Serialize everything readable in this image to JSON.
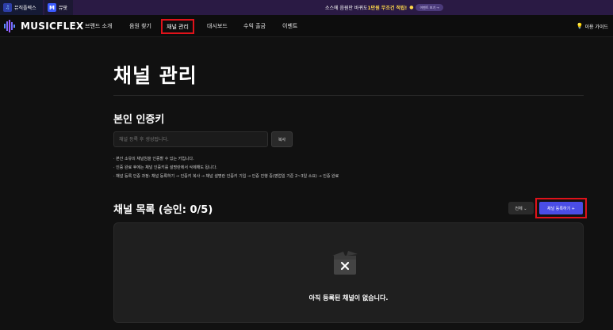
{
  "topbar": {
    "tabs": [
      {
        "label": "뮤직플렉스",
        "icon": "musicflex-icon"
      },
      {
        "label": "뮤팟",
        "icon": "M"
      }
    ],
    "promo": {
      "text_before": "소스에 음원만 바뀌도 ",
      "highlight": "1만원 무조건 적립!",
      "badge": "이벤트 보기 →"
    }
  },
  "nav": {
    "logo": "MUSICFLEX",
    "items": [
      "브랜드 소개",
      "음원 찾기",
      "채널 관리",
      "대시보드",
      "수익 출금",
      "이벤트"
    ],
    "active_index": 2,
    "guide": "이용 가이드"
  },
  "main": {
    "title": "채널 관리",
    "auth_key": {
      "title": "본인 인증키",
      "placeholder": "채널 등록 후 생성됩니다.",
      "copy_label": "복사",
      "notes": [
        "· 본인 소유의 채널임을 인증할 수 있는 키입니다.",
        "· 인증 완료 후에는 채널 인증키를 설명란에서 삭제해도 됩니다.",
        "· 채널 등록 인증 과정: 채널 등록하기 → 인증키 복사 → 채널 설명란 인증키 기입 → 인증 진행 중(영업일 기준 2~3일 소요) → 인증 완료"
      ]
    },
    "channel_list": {
      "title": "채널 목록 (승인: 0/5)",
      "filter_label": "전체 ⌄",
      "register_label": "채널 등록하기 +",
      "empty_text": "아직 등록된 채널이 없습니다."
    }
  },
  "colors": {
    "accent": "#4a4de6",
    "highlight_box": "#e0121a",
    "promo_highlight": "#ffd84a"
  }
}
